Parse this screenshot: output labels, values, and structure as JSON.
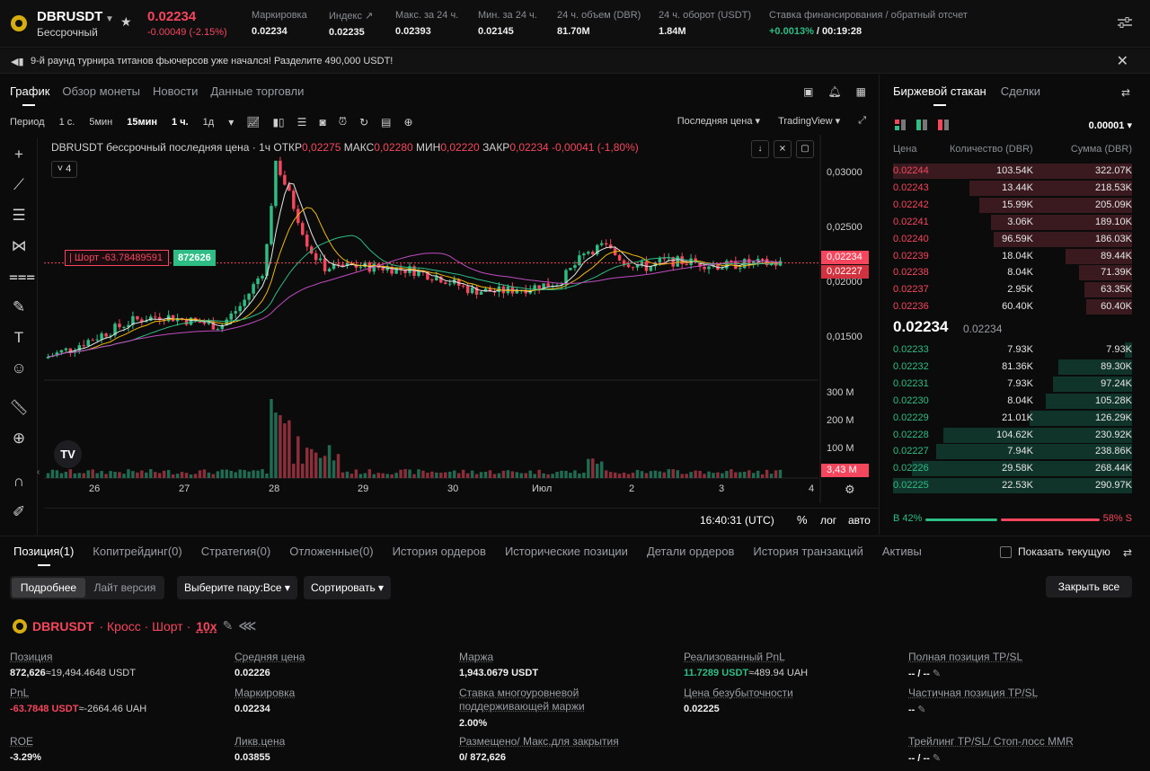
{
  "header": {
    "symbol": "DBRUSDT",
    "contract": "Бессрочный",
    "price": "0.02234",
    "change": "-0.00049 (-2.15%)",
    "stats": [
      {
        "label": "Маркировка",
        "value": "0.02234"
      },
      {
        "label": "Индекс",
        "value": "0.02235"
      },
      {
        "label": "Макс. за 24 ч.",
        "value": "0.02393"
      },
      {
        "label": "Мин. за 24 ч.",
        "value": "0.02145"
      },
      {
        "label": "24 ч. объем (DBR)",
        "value": "81.70M"
      },
      {
        "label": "24 ч. оборот (USDT)",
        "value": "1.84M"
      }
    ],
    "funding_label": "Ставка финансирования / обратный отсчет",
    "funding_rate": "+0.0013%",
    "funding_countdown": "/ 00:19:28"
  },
  "announcement": "9-й раунд турнира титанов фьючерсов уже начался! Разделите 490,000 USDT!",
  "chart_tabs": [
    "График",
    "Обзор монеты",
    "Новости",
    "Данные торговли"
  ],
  "toolbar": {
    "period_label": "Период",
    "intervals": [
      "1 с.",
      "5мин",
      "15мин",
      "1 ч.",
      "1д"
    ],
    "price_type": "Последняя цена ▾",
    "view": "TradingView ▾"
  },
  "chart": {
    "legend_title": "DBRUSDT бессрочный последняя цена · 1ч",
    "open_label": "ОТКР",
    "open": "0,02275",
    "high_label": "МАКС",
    "high": "0,02280",
    "low_label": "МИН",
    "low": "0,02220",
    "close_label": "ЗАКР",
    "close": "0,02234",
    "chg": "-0,00041 (-1,80%)",
    "collapse_count": "4",
    "short_label": "Шорт -63.78489591",
    "short_qty": "872626",
    "price_tag": "0,02234",
    "price_tag2": "0,02227",
    "vol_tag": "3,43 M",
    "time": "16:40:31 (UTC)",
    "pct": "%",
    "log": "лог",
    "auto": "авто"
  },
  "chart_data": {
    "type": "candlestick",
    "y_ticks": [
      "0,03000",
      "0,02500",
      "0,02000",
      "0,01500"
    ],
    "ylim": [
      0.0135,
      0.0318
    ],
    "volume_ticks": [
      "300 M",
      "200 M",
      "100 M"
    ],
    "x_ticks": [
      "26",
      "27",
      "28",
      "29",
      "30",
      "Июл",
      "2",
      "3",
      "4"
    ],
    "last_price": 0.02234,
    "entry_price": 0.02226
  },
  "orderbook": {
    "tabs": [
      "Биржевой стакан",
      "Сделки"
    ],
    "tick": "0.00001 ▾",
    "headers": {
      "price": "Цена",
      "qty": "Количество (DBR)",
      "sum": "Сумма (DBR)"
    },
    "asks": [
      {
        "p": "0.02244",
        "q": "103.54K",
        "s": "322.07K",
        "d": 1.0
      },
      {
        "p": "0.02243",
        "q": "13.44K",
        "s": "218.53K",
        "d": 0.68
      },
      {
        "p": "0.02242",
        "q": "15.99K",
        "s": "205.09K",
        "d": 0.64
      },
      {
        "p": "0.02241",
        "q": "3.06K",
        "s": "189.10K",
        "d": 0.59
      },
      {
        "p": "0.02240",
        "q": "96.59K",
        "s": "186.03K",
        "d": 0.58
      },
      {
        "p": "0.02239",
        "q": "18.04K",
        "s": "89.44K",
        "d": 0.28
      },
      {
        "p": "0.02238",
        "q": "8.04K",
        "s": "71.39K",
        "d": 0.22
      },
      {
        "p": "0.02237",
        "q": "2.95K",
        "s": "63.35K",
        "d": 0.2
      },
      {
        "p": "0.02236",
        "q": "60.40K",
        "s": "60.40K",
        "d": 0.19
      }
    ],
    "mid": "0.02234",
    "mid_sub": "0.02234",
    "bids": [
      {
        "p": "0.02233",
        "q": "7.93K",
        "s": "7.93K",
        "d": 0.03
      },
      {
        "p": "0.02232",
        "q": "81.36K",
        "s": "89.30K",
        "d": 0.31
      },
      {
        "p": "0.02231",
        "q": "7.93K",
        "s": "97.24K",
        "d": 0.33
      },
      {
        "p": "0.02230",
        "q": "8.04K",
        "s": "105.28K",
        "d": 0.36
      },
      {
        "p": "0.02229",
        "q": "21.01K",
        "s": "126.29K",
        "d": 0.43
      },
      {
        "p": "0.02228",
        "q": "104.62K",
        "s": "230.92K",
        "d": 0.79
      },
      {
        "p": "0.02227",
        "q": "7.94K",
        "s": "238.86K",
        "d": 0.82
      },
      {
        "p": "0.02226",
        "q": "29.58K",
        "s": "268.44K",
        "d": 0.92
      },
      {
        "p": "0.02225",
        "q": "22.53K",
        "s": "290.97K",
        "d": 1.0
      }
    ],
    "buy_ratio": "B 42%",
    "sell_ratio": "58% S"
  },
  "bottom": {
    "tabs": [
      "Позиция(1)",
      "Копитрейдинг(0)",
      "Стратегия(0)",
      "Отложенные(0)",
      "История ордеров",
      "Исторические позиции",
      "Детали ордеров",
      "История транзакций",
      "Активы"
    ],
    "show_current": "Показать текущую",
    "seg_a": "Подробнее",
    "seg_b": "Лайт версия",
    "pair_select": "Выберите пару:Все ▾",
    "sort": "Сортировать ▾",
    "close_all": "Закрыть все",
    "position": {
      "symbol": "DBRUSDT",
      "mode": "· Кросс · Шорт ·",
      "leverage": "10x"
    },
    "fields": {
      "position_label": "Позиция",
      "position_value": "872,626",
      "position_sub": "≈19,494.4648 USDT",
      "pnl_label": "PnL",
      "pnl_value": "-63.7848 USDT",
      "pnl_sub": "≈-2664.46 UAH",
      "roe_label": "ROE",
      "roe_value": "-3.29%",
      "avg_label": "Средняя цена",
      "avg_value": "0.02226",
      "mark_label": "Маркировка",
      "mark_value": "0.02234",
      "liq_label": "Ликв.цена",
      "liq_value": "0.03855",
      "margin_label": "Маржа",
      "margin_value": "1,943.0679 USDT",
      "mmr_label": "Ставка многоуровневой поддерживающей маржи",
      "mmr_value": "2.00%",
      "placed_label": "Размещено/ Макс.для закрытия",
      "placed_value": "0/ 872,626",
      "rpnl_label": "Реализованный PnL",
      "rpnl_value": "11.7289 USDT",
      "rpnl_sub": "≈489.94 UAH",
      "be_label": "Цена безубыточности",
      "be_value": "0.02225",
      "tpsl_full_label": "Полная позиция TP/SL",
      "tpsl_full_value": "-- / --",
      "tpsl_part_label": "Частичная позиция TP/SL",
      "tpsl_part_value": "--",
      "trail_label": "Трейлинг TP/SL/ Стоп-лосс MMR",
      "trail_value": "-- / --"
    }
  }
}
